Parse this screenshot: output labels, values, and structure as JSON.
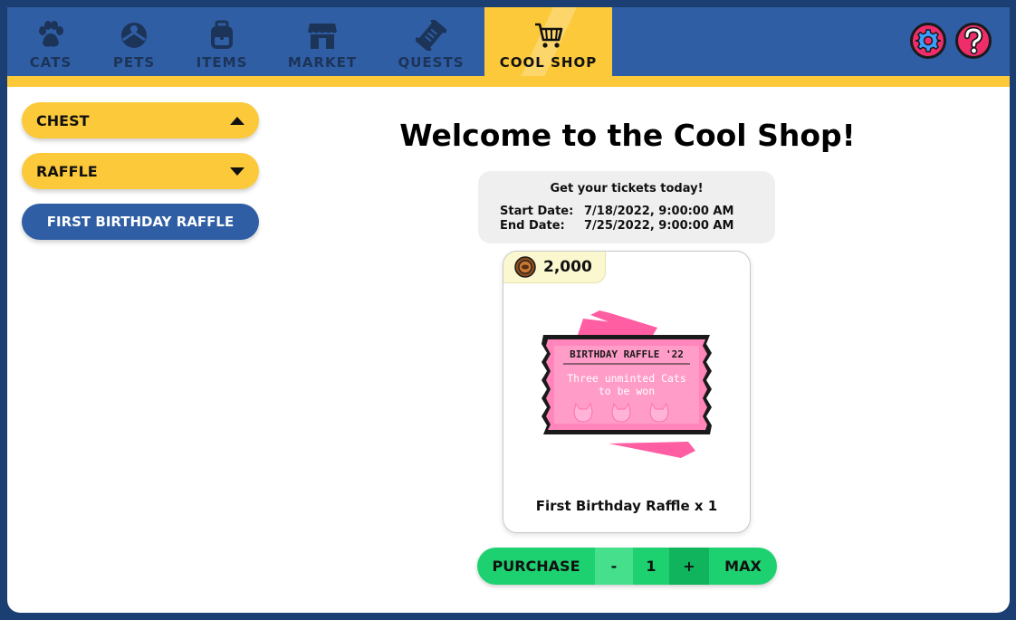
{
  "nav": {
    "tabs": [
      {
        "label": "CATS",
        "icon": "paw-icon"
      },
      {
        "label": "PETS",
        "icon": "pet-ball-icon"
      },
      {
        "label": "ITEMS",
        "icon": "backpack-icon"
      },
      {
        "label": "MARKET",
        "icon": "storefront-icon"
      },
      {
        "label": "QUESTS",
        "icon": "scroll-icon"
      },
      {
        "label": "COOL SHOP",
        "icon": "shopping-cart-icon",
        "active": true
      }
    ],
    "settings_icon": "gear-icon",
    "help_icon": "question-mark-icon"
  },
  "sidebar": {
    "categories": [
      {
        "label": "CHEST",
        "state": "expanded"
      },
      {
        "label": "RAFFLE",
        "state": "collapsed"
      }
    ],
    "selected_item": "FIRST BIRTHDAY RAFFLE"
  },
  "main": {
    "title": "Welcome to the Cool Shop!",
    "info": {
      "headline": "Get your tickets today!",
      "start_label": "Start Date:",
      "start_value": "7/18/2022, 9:00:00 AM",
      "end_label": "End Date:",
      "end_value": "7/25/2022, 9:00:00 AM"
    },
    "card": {
      "price": "2,000",
      "ticket_title": "BIRTHDAY RAFFLE '22",
      "ticket_line1": "Three unminted Cats",
      "ticket_line2": "to be won",
      "caption": "First Birthday Raffle x 1"
    },
    "purchase": {
      "purchase_label": "PURCHASE",
      "minus_label": "-",
      "quantity": "1",
      "plus_label": "+",
      "max_label": "MAX"
    }
  },
  "colors": {
    "nav_blue": "#2f5ea4",
    "accent_yellow": "#fbc93a",
    "purchase_green": "#1ed170",
    "ticket_pink": "#ff85bb",
    "help_red": "#ef2d6a"
  }
}
